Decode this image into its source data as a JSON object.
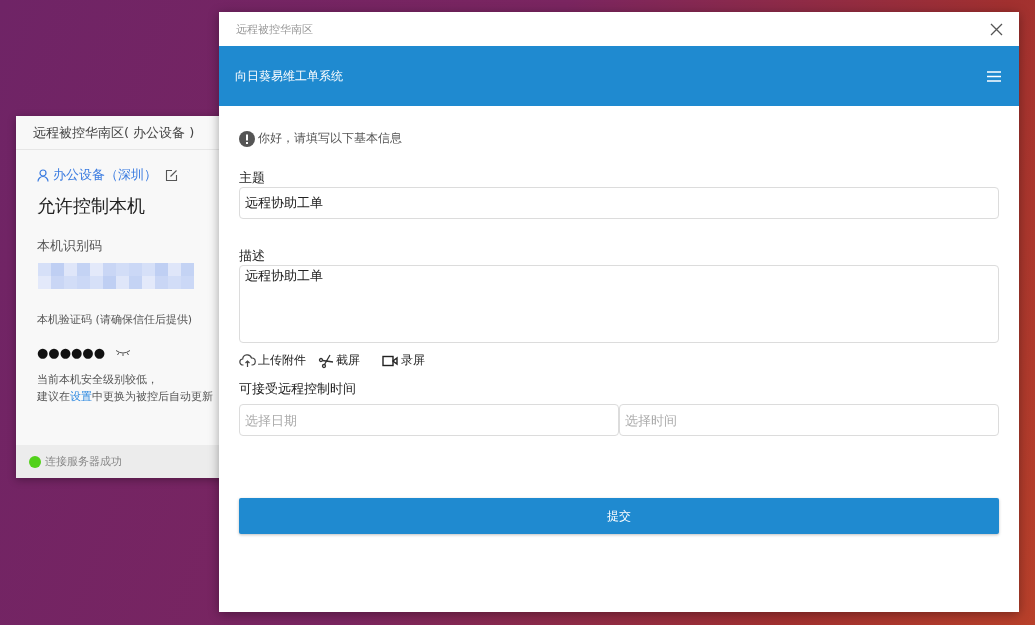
{
  "back_window": {
    "title": "远程被控华南区( 办公设备 )",
    "device_name": "办公设备（深圳）",
    "heading": "允许控制本机",
    "id_label": "本机识别码",
    "code_label": "本机验证码 (请确保信任后提供)",
    "code_value": "●●●●●●",
    "warning_line1": "当前本机安全级别较低，",
    "warning_before": "建议在",
    "warning_link": "设置",
    "warning_after": "中更换为被控后自动更新",
    "status": {
      "text": "连接服务器成功",
      "connected": true
    }
  },
  "window": {
    "title": "远程被控华南区"
  },
  "header": {
    "title": "向日葵易维工单系统"
  },
  "notice": "你好，请填写以下基本信息",
  "subject": {
    "label": "主题",
    "value": "远程协助工单"
  },
  "description": {
    "label": "描述",
    "value": "远程协助工单"
  },
  "tools": [
    {
      "kind": "upload",
      "label": "上传附件"
    },
    {
      "kind": "screenshot",
      "label": "截屏"
    },
    {
      "kind": "record",
      "label": "录屏"
    }
  ],
  "time": {
    "label": "可接受远程控制时间",
    "date_placeholder": "选择日期",
    "time_placeholder": "选择时间"
  },
  "submit": "提交"
}
